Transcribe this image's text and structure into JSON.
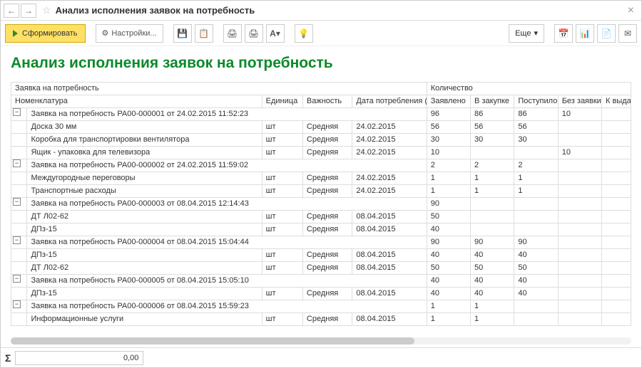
{
  "title": "Анализ исполнения заявок на потребность",
  "toolbar": {
    "form": "Сформировать",
    "settings": "Настройки...",
    "more": "Еще"
  },
  "report_title": "Анализ исполнения заявок на потребность",
  "headers": {
    "request": "Заявка на потребность",
    "qty": "Количество",
    "nom": "Номенклатура",
    "unit": "Единица",
    "imp": "Важность",
    "date": "Дата потребления (план)",
    "declared": "Заявлено",
    "inpurch": "В закупке",
    "received": "Поступило",
    "noreq": "Без заявки",
    "toissue": "К выда"
  },
  "groups": [
    {
      "title": "Заявка на потребность РА00-000001 от 24.02.2015 11:52:23",
      "totals": {
        "declared": "96",
        "inpurch": "86",
        "received": "86",
        "noreq": "10"
      },
      "rows": [
        {
          "nom": "Доска 30 мм",
          "unit": "шт",
          "imp": "Средняя",
          "date": "24.02.2015",
          "declared": "56",
          "inpurch": "56",
          "received": "56",
          "noreq": ""
        },
        {
          "nom": "Коробка для транспортировки вентилятора",
          "unit": "шт",
          "imp": "Средняя",
          "date": "24.02.2015",
          "declared": "30",
          "inpurch": "30",
          "received": "30",
          "noreq": ""
        },
        {
          "nom": "Ящик - упаковка для телевизора",
          "unit": "шт",
          "imp": "Средняя",
          "date": "24.02.2015",
          "declared": "10",
          "inpurch": "",
          "received": "",
          "noreq": "10"
        }
      ]
    },
    {
      "title": "Заявка на потребность РА00-000002 от 24.02.2015 11:59:02",
      "totals": {
        "declared": "2",
        "inpurch": "2",
        "received": "2",
        "noreq": ""
      },
      "rows": [
        {
          "nom": "Междугородные переговоры",
          "unit": "шт",
          "imp": "Средняя",
          "date": "24.02.2015",
          "declared": "1",
          "inpurch": "1",
          "received": "1",
          "noreq": ""
        },
        {
          "nom": "Транспортные расходы",
          "unit": "шт",
          "imp": "Средняя",
          "date": "24.02.2015",
          "declared": "1",
          "inpurch": "1",
          "received": "1",
          "noreq": ""
        }
      ]
    },
    {
      "title": "Заявка на потребность РА00-000003 от 08.04.2015 12:14:43",
      "totals": {
        "declared": "90",
        "inpurch": "",
        "received": "",
        "noreq": ""
      },
      "rows": [
        {
          "nom": "ДТ Л02-62",
          "unit": "шт",
          "imp": "Средняя",
          "date": "08.04.2015",
          "declared": "50",
          "inpurch": "",
          "received": "",
          "noreq": ""
        },
        {
          "nom": "ДПз-15",
          "unit": "шт",
          "imp": "Средняя",
          "date": "08.04.2015",
          "declared": "40",
          "inpurch": "",
          "received": "",
          "noreq": ""
        }
      ]
    },
    {
      "title": "Заявка на потребность РА00-000004 от 08.04.2015 15:04:44",
      "totals": {
        "declared": "90",
        "inpurch": "90",
        "received": "90",
        "noreq": ""
      },
      "rows": [
        {
          "nom": "ДПз-15",
          "unit": "шт",
          "imp": "Средняя",
          "date": "08.04.2015",
          "declared": "40",
          "inpurch": "40",
          "received": "40",
          "noreq": ""
        },
        {
          "nom": "ДТ Л02-62",
          "unit": "шт",
          "imp": "Средняя",
          "date": "08.04.2015",
          "declared": "50",
          "inpurch": "50",
          "received": "50",
          "noreq": ""
        }
      ]
    },
    {
      "title": "Заявка на потребность РА00-000005 от 08.04.2015 15:05:10",
      "totals": {
        "declared": "40",
        "inpurch": "40",
        "received": "40",
        "noreq": ""
      },
      "rows": [
        {
          "nom": "ДПз-15",
          "unit": "шт",
          "imp": "Средняя",
          "date": "08.04.2015",
          "declared": "40",
          "inpurch": "40",
          "received": "40",
          "noreq": ""
        }
      ]
    },
    {
      "title": "Заявка на потребность РА00-000006 от 08.04.2015 15:59:23",
      "totals": {
        "declared": "1",
        "inpurch": "1",
        "received": "",
        "noreq": ""
      },
      "rows": [
        {
          "nom": "Информационные услуги",
          "unit": "шт",
          "imp": "Средняя",
          "date": "08.04.2015",
          "declared": "1",
          "inpurch": "1",
          "received": "",
          "noreq": ""
        }
      ]
    }
  ],
  "status": {
    "sum": "0,00"
  }
}
